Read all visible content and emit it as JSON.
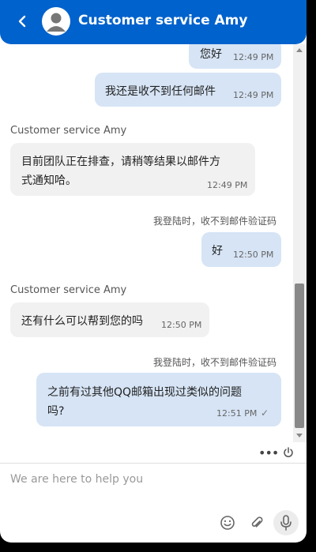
{
  "header": {
    "title": "Customer service Amy"
  },
  "messages": [
    {
      "type": "out",
      "text": "您好",
      "time": "12:49 PM"
    },
    {
      "type": "out",
      "text": "我还是收不到任何邮件",
      "time": "12:49 PM"
    },
    {
      "type": "in",
      "sender": "Customer service Amy",
      "line1": "目前团队正在排查，请稍等结果以邮件方",
      "line2": "式通知哈。",
      "time": "12:49 PM"
    },
    {
      "type": "out",
      "quote": "我登陆时，收不到邮件验证码",
      "text": "好",
      "time": "12:50 PM"
    },
    {
      "type": "in",
      "sender": "Customer service Amy",
      "text": "还有什么可以帮到您的吗",
      "time": "12:50 PM"
    },
    {
      "type": "out",
      "quote": "我登陆时，收不到邮件验证码",
      "line1": "之前有过其他QQ邮箱出现过类似的问题",
      "line2": "吗?",
      "time": "12:51 PM",
      "status": "✓"
    }
  ],
  "toolbar": {
    "more": "•••"
  },
  "input": {
    "placeholder": "We are here to help you"
  },
  "colors": {
    "header": "#0062cc",
    "outgoing_bubble": "#d6e4f5",
    "incoming_bubble": "#f1f1f1"
  },
  "icons": [
    "back-arrow-icon",
    "avatar-icon",
    "more-icon",
    "power-icon",
    "emoji-icon",
    "attachment-icon",
    "microphone-icon"
  ]
}
